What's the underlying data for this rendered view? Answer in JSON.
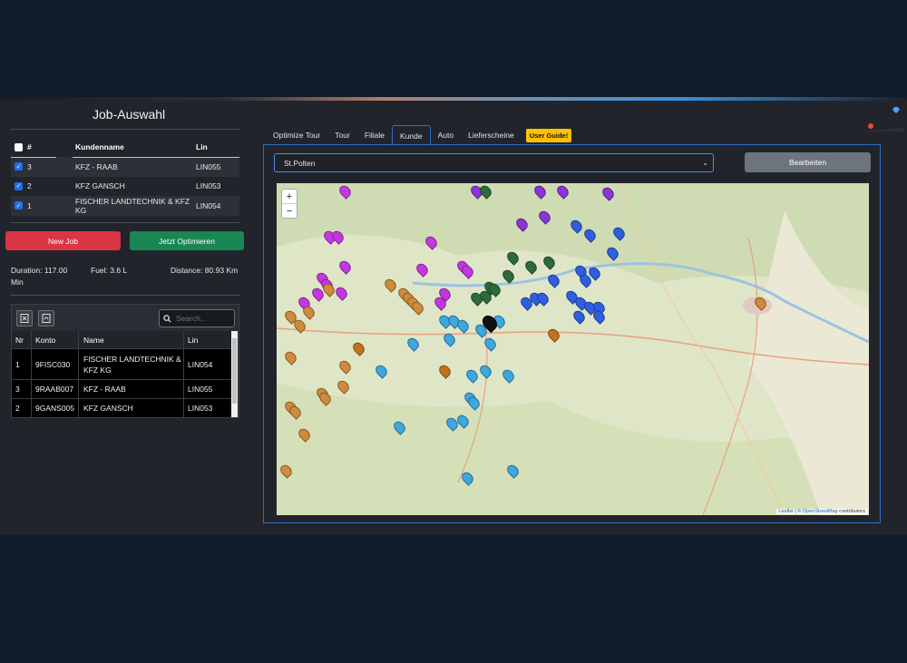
{
  "left_panel": {
    "title": "Job-Auswahl",
    "job_table": {
      "headers": {
        "num": "#",
        "name": "Kundenname",
        "lin": "Lin"
      },
      "rows": [
        {
          "num": "3",
          "name": "KFZ - RAAB",
          "lin": "LIN055",
          "checked": true
        },
        {
          "num": "2",
          "name": "KFZ GANSCH",
          "lin": "LIN053",
          "checked": true
        },
        {
          "num": "1",
          "name": "FISCHER LANDTECHNIK & KFZ KG",
          "lin": "LIN054",
          "checked": true
        }
      ]
    },
    "new_job_label": "New Job",
    "optimize_label": "Jetzt Optimieren",
    "stats": {
      "duration": "Duration: 117.00",
      "duration_unit": "Min",
      "fuel": "Fuel: 3.6 L",
      "distance": "Distance: 80.93 Km"
    },
    "search": {
      "placeholder": "Search..."
    },
    "result_table": {
      "headers": {
        "nr": "Nr",
        "konto": "Konto",
        "name": "Name",
        "lin": "Lin"
      },
      "rows": [
        {
          "nr": "1",
          "konto": "9FISC030",
          "name": "FISCHER LANDTECHNIK & KFZ KG",
          "lin": "LIN054"
        },
        {
          "nr": "3",
          "konto": "9RAAB007",
          "name": "KFZ - RAAB",
          "lin": "LIN055"
        },
        {
          "nr": "2",
          "konto": "9GANS005",
          "name": "KFZ GANSCH",
          "lin": "LIN053"
        }
      ]
    }
  },
  "right_panel": {
    "tabs": [
      {
        "label": "Optimize Tour",
        "active": false
      },
      {
        "label": "Tour",
        "active": false
      },
      {
        "label": "Filiale",
        "active": false
      },
      {
        "label": "Kunde",
        "active": true
      },
      {
        "label": "Auto",
        "active": false
      },
      {
        "label": "Lieferscheine",
        "active": false
      }
    ],
    "guide_label": "User Guide!",
    "select_value": "St.Polten",
    "edit_label": "Bearbeiten",
    "map": {
      "zoom_in": "+",
      "zoom_out": "−",
      "attribution_leaflet": "Leaflet",
      "attribution_sep": " | © ",
      "attribution_osm": "OpenStreetMap",
      "attribution_tail": " contributors",
      "marker_colors": [
        "#2f5fe0",
        "#3da7e0",
        "#c437e0",
        "#8a35d8",
        "#2e6a3a",
        "#d08a3c",
        "#c2721a"
      ]
    }
  },
  "colors": {
    "accent": "#2d6fc4",
    "danger": "#dc3545",
    "success": "#198754",
    "warning": "#ffc107"
  }
}
